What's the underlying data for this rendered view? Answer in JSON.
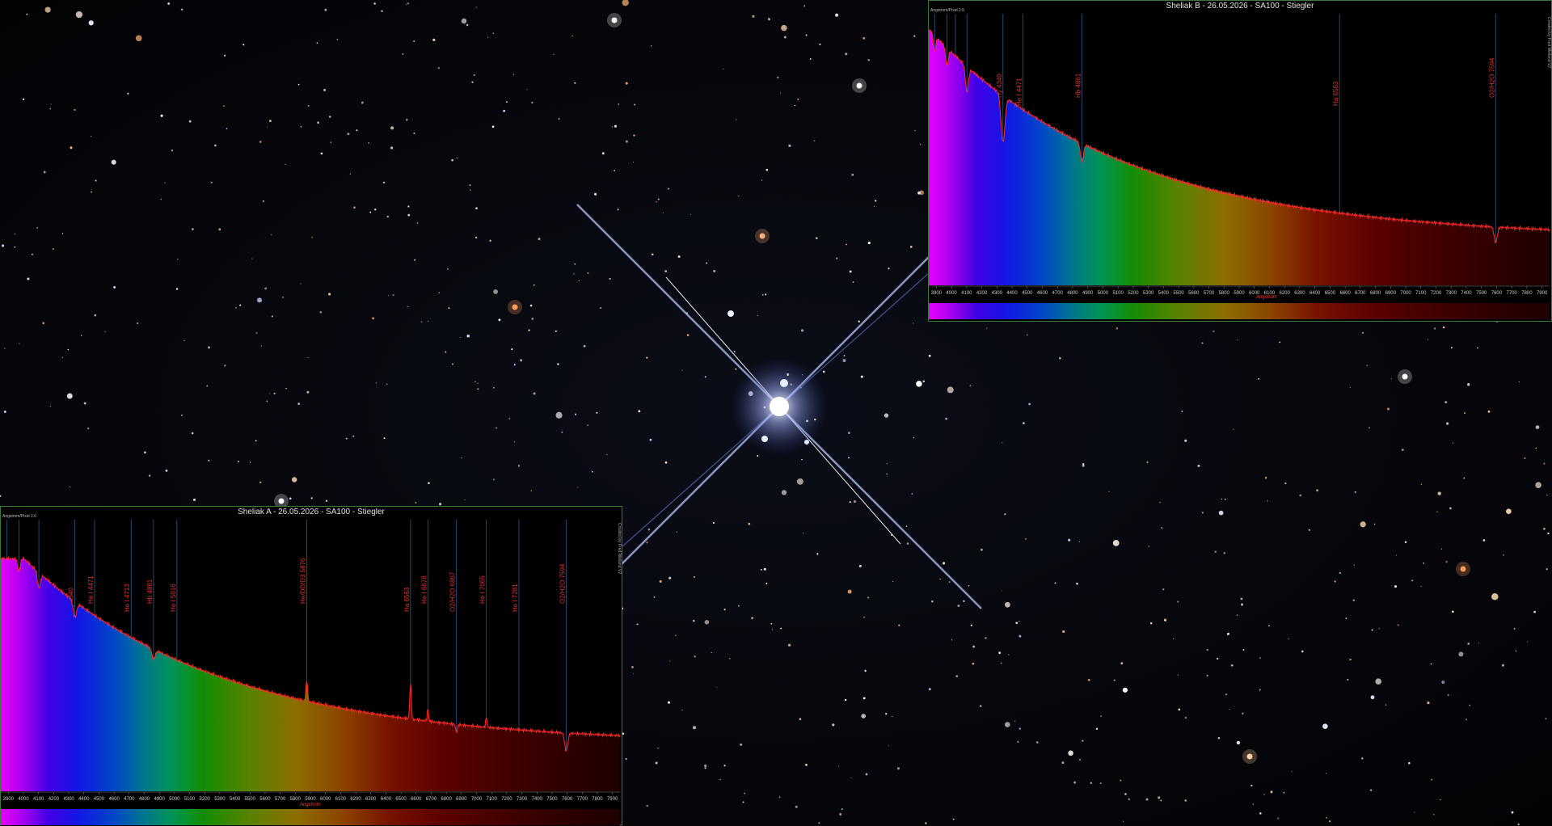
{
  "scene": {
    "description_colors": {
      "sky": "#05060a",
      "star_white": "#ffffff",
      "star_orange": "#ffb060",
      "star_blue": "#9fb8ff",
      "spike_core": "#e8ecff"
    }
  },
  "panels": [
    {
      "id": "panel-a",
      "title": "Sheliak A - 26.05.2026 - SA100 - Stiegler",
      "ylabel": "Angstrom/Pixel 2.6",
      "xunit": "Angstrom",
      "right_label": "Created by Fred Weiland V2",
      "x_ticks": [
        3900,
        4000,
        4100,
        4200,
        4300,
        4400,
        4500,
        4600,
        4700,
        4800,
        4900,
        5000,
        5100,
        5200,
        5300,
        5400,
        5500,
        5600,
        5700,
        5800,
        5900,
        6000,
        6100,
        6200,
        6300,
        6400,
        6500,
        6600,
        6700,
        6800,
        6900,
        7000,
        7100,
        7200,
        7300,
        7400,
        7500,
        7600,
        7700,
        7800,
        7900
      ],
      "lines": [
        {
          "label": "He 3889",
          "wl": 3889
        },
        {
          "label": "He 3970",
          "wl": 3970
        },
        {
          "label": "He/Hs 4102",
          "wl": 4102
        },
        {
          "label": "Hy 4340",
          "wl": 4340
        },
        {
          "label": "He I 4471",
          "wl": 4471
        },
        {
          "label": "He I 4713",
          "wl": 4713
        },
        {
          "label": "Hb 4861",
          "wl": 4861
        },
        {
          "label": "He I 5016",
          "wl": 5016
        },
        {
          "label": "He/DD/D3 5876",
          "wl": 5876
        },
        {
          "label": "Ha 6563",
          "wl": 6563
        },
        {
          "label": "He I 6678",
          "wl": 6678
        },
        {
          "label": "O2/H2O 6867",
          "wl": 6867
        },
        {
          "label": "He I 7065",
          "wl": 7065
        },
        {
          "label": "He I 7281",
          "wl": 7281
        },
        {
          "label": "O2/H2O 7594",
          "wl": 7594
        }
      ]
    },
    {
      "id": "panel-b",
      "title": "Sheliak B - 26.05.2026 - SA100 - Stiegler",
      "ylabel": "Angstrom/Pixel 2.6",
      "xunit": "Angstrom",
      "right_label": "Created by Fred Weiland V2",
      "x_ticks": [
        3900,
        4000,
        4100,
        4200,
        4300,
        4400,
        4500,
        4600,
        4700,
        4800,
        4900,
        5000,
        5100,
        5200,
        5300,
        5400,
        5500,
        5600,
        5700,
        5800,
        5900,
        6000,
        6100,
        6200,
        6300,
        6400,
        6500,
        6600,
        6700,
        6800,
        6900,
        7000,
        7100,
        7200,
        7300,
        7400,
        7500,
        7600,
        7700,
        7800,
        7900
      ],
      "lines": [
        {
          "label": "Hs 3889",
          "wl": 3889
        },
        {
          "label": "Hs 3970",
          "wl": 3970
        },
        {
          "label": "He 4026",
          "wl": 4026
        },
        {
          "label": "Hs 4102",
          "wl": 4102
        },
        {
          "label": "Hy 4340",
          "wl": 4340
        },
        {
          "label": "He I 4471",
          "wl": 4471
        },
        {
          "label": "Hb 4861",
          "wl": 4861
        },
        {
          "label": "Ha 6563",
          "wl": 6563
        },
        {
          "label": "O2/H2O 7594",
          "wl": 7594
        }
      ]
    }
  ]
}
